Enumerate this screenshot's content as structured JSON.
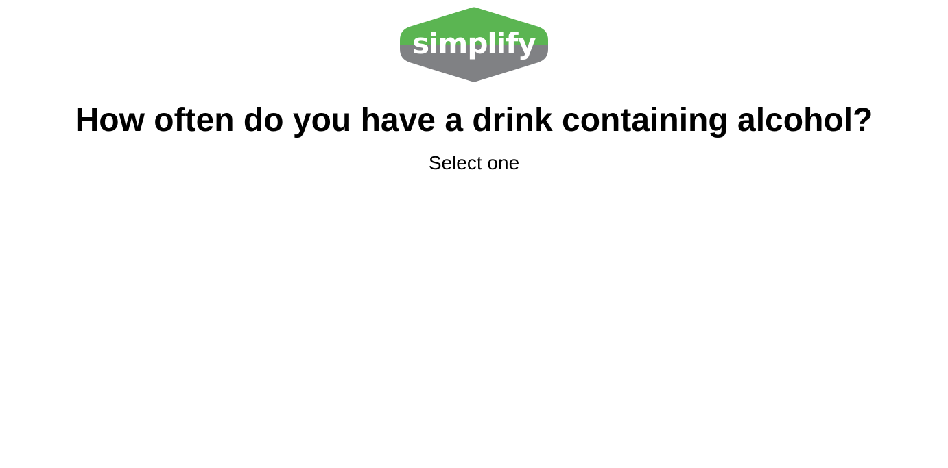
{
  "brand": {
    "logo_text": "simplify",
    "colors": {
      "green": "#5bb552",
      "gray": "#808184",
      "text": "#ffffff"
    }
  },
  "question": {
    "title": "How often do you have a drink containing alcohol?",
    "instruction": "Select one"
  }
}
